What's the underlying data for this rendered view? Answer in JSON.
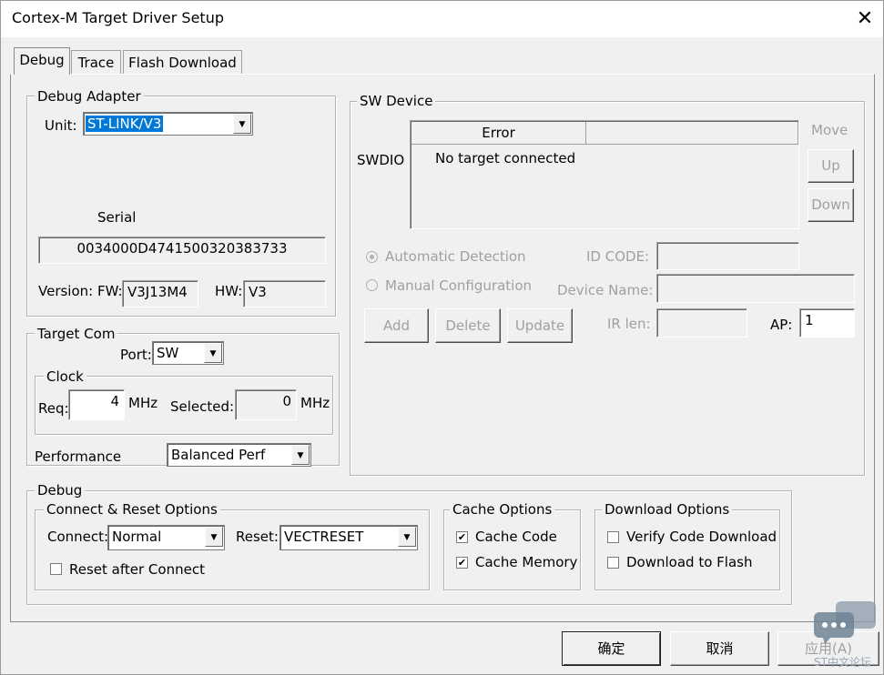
{
  "window": {
    "title": "Cortex-M Target Driver Setup",
    "close_glyph": "✕"
  },
  "tabs": [
    {
      "label": "Debug",
      "active": true
    },
    {
      "label": "Trace",
      "active": false
    },
    {
      "label": "Flash Download",
      "active": false
    }
  ],
  "debug_adapter": {
    "title": "Debug Adapter",
    "unit_label": "Unit:",
    "unit_value": "ST-LINK/V3",
    "serial_label": "Serial",
    "serial_value": "0034000D4741500320383733",
    "version_label": "Version: FW:",
    "fw_value": "V3J13M4",
    "hw_label": "HW:",
    "hw_value": "V3"
  },
  "target_com": {
    "title": "Target Com",
    "port_label": "Port:",
    "port_value": "SW",
    "clock": {
      "title": "Clock",
      "req_label": "Req:",
      "req_value": "4",
      "req_unit": "MHz",
      "selected_label": "Selected:",
      "selected_value": "0",
      "selected_unit": "MHz"
    },
    "performance_label": "Performance",
    "performance_value": "Balanced Perf"
  },
  "sw_device": {
    "title": "SW Device",
    "move_label": "Move",
    "up_label": "Up",
    "down_label": "Down",
    "row_label": "SWDIO",
    "columns": [
      "Error",
      ""
    ],
    "rows": [
      {
        "value": "No target connected"
      }
    ],
    "auto_detect_label": "Automatic Detection",
    "manual_config_label": "Manual Configuration",
    "id_code_label": "ID CODE:",
    "device_name_label": "Device Name:",
    "ir_len_label": "IR len:",
    "ap_label": "AP:",
    "ap_value": "1",
    "add_label": "Add",
    "delete_label": "Delete",
    "update_label": "Update"
  },
  "debug": {
    "title": "Debug",
    "connect_reset": {
      "title": "Connect & Reset Options",
      "connect_label": "Connect:",
      "connect_value": "Normal",
      "reset_label": "Reset:",
      "reset_value": "VECTRESET",
      "reset_after_label": "Reset after Connect",
      "reset_after_checked": false
    },
    "cache": {
      "title": "Cache Options",
      "cache_code_label": "Cache Code",
      "cache_code_checked": true,
      "cache_memory_label": "Cache Memory",
      "cache_memory_checked": true
    },
    "download": {
      "title": "Download Options",
      "verify_label": "Verify Code Download",
      "verify_checked": false,
      "to_flash_label": "Download to Flash",
      "to_flash_checked": false
    }
  },
  "footer": {
    "ok_label": "确定",
    "cancel_label": "取消",
    "apply_label": "应用(A)"
  },
  "watermark": "ST中文论坛",
  "check_glyph": "✔",
  "dropdown_glyph": "▼"
}
